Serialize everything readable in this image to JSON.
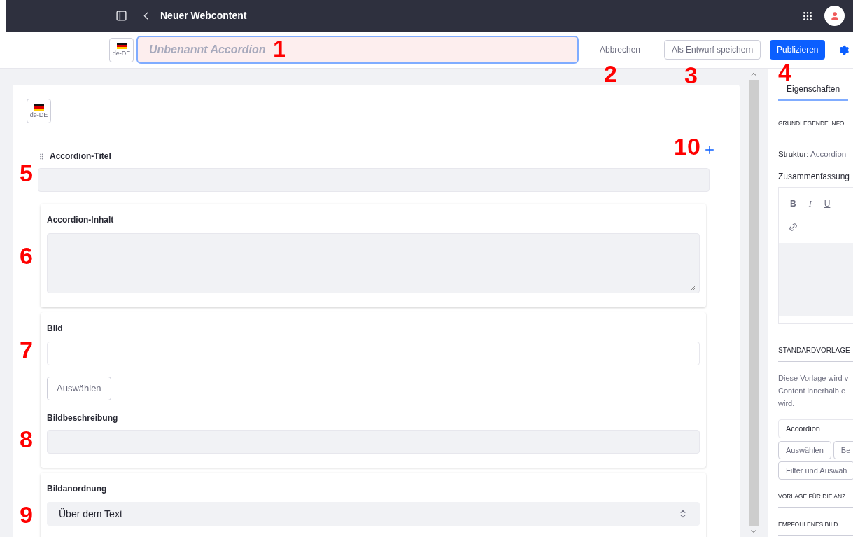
{
  "topbar": {
    "title": "Neuer Webcontent"
  },
  "header": {
    "locale": "de-DE",
    "title_placeholder": "Unbenannt Accordion",
    "buttons": [
      {
        "kind": "link",
        "label": "Abbrechen"
      },
      {
        "kind": "secondary",
        "label": "Als Entwurf speichern"
      },
      {
        "kind": "primary",
        "label": "Publizieren"
      }
    ]
  },
  "form": {
    "locale": "de-DE",
    "repeatable": {
      "label": "Accordion-Titel",
      "cards": [
        {
          "fields": [
            {
              "kind": "textarea",
              "label": "Accordion-Inhalt"
            }
          ]
        },
        {
          "fields": [
            {
              "kind": "image",
              "label": "Bild",
              "button": "Auswählen"
            },
            {
              "kind": "text",
              "label": "Bildbeschreibung"
            }
          ]
        },
        {
          "fields": [
            {
              "kind": "select",
              "label": "Bildanordnung",
              "value": "Über dem Text"
            }
          ]
        }
      ]
    }
  },
  "sidebar": {
    "tabs": [
      {
        "label": "Eigenschaften",
        "selected": true
      }
    ],
    "section_1": {
      "heading": "GRUNDLEGENDE INFO",
      "structure_label": "Struktur:",
      "structure_value": "Accordion",
      "summary_label": "Zusammenfassung",
      "editor_tools": [
        "B",
        "I",
        "U"
      ]
    },
    "section_2": {
      "heading": "STANDARDVORLAGE",
      "description_lines": [
        "Diese Vorlage wird v",
        "Content innerhalb e",
        "wird."
      ],
      "template": "Accordion",
      "buttons": [
        "Auswählen",
        "Be",
        "Filter und Auswah"
      ]
    },
    "headings": [
      "VORLAGE FÜR DIE ANZ",
      "EMPFOHLENES BILD"
    ]
  },
  "annotations": [
    "1",
    "2",
    "3",
    "4",
    "5",
    "6",
    "7",
    "8",
    "9",
    "10"
  ]
}
